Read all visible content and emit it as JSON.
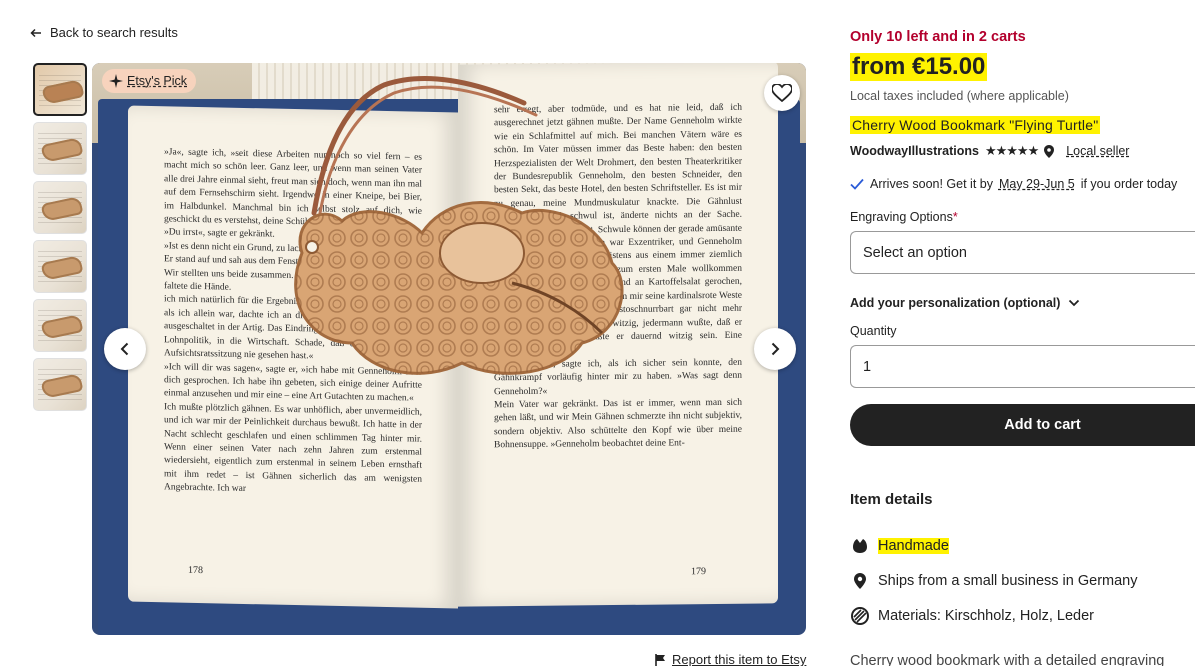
{
  "nav": {
    "back_label": "Back to search results"
  },
  "gallery": {
    "badge": "Etsy's Pick",
    "thumbnail_count": 6,
    "left_page_text": "»Ja«, sagte ich, »seit diese Arbeiten nur noch so viel fern – es macht mich so schön leer. Ganz leer, und wenn man seinen Vater alle drei Jahre einmal sieht, freut man sich doch, wenn man ihn mal auf dem Fernsehschirm sieht. Irgendwo in einer Kneipe, bei Bier, im Halbdunkel. Manchmal bin ich selbst stolz auf dich, wie geschickt du es verstehst, deine Schüler zur Prozentzahl fragt.«\n»Du irrst«, sagte er gekränkt.\n»Ist es denn nicht ein Grund, zu lachen, wenn alle haben?«\nEr stand auf und sah aus dem Fenster.\nWir stellten uns beide zusammen. Er lehnte sich auf die Lehne. Ich faltete die Hände.\nich mich natürlich für die Ergebnisse der Umfrage, mime. Einmal, als ich allein war, dachte ich an die Arbeit saß, hab ich den Ton ausgeschaltet in der Artig. Das Eindringen des l'art pour l'art in die Lohnpolitik, in die Wirtschaft. Schade, daß du damals diesen Aufsichtsratssitzung nie gesehen hast.«\n»Ich will dir was sagen«, sagte er, »ich habe mit Genneholm über dich gesprochen. Ich habe ihn gebeten, sich einige deiner Aufritte einmal anzusehen und mir eine – eine Art Gutachten zu machen.«\nIch mußte plötzlich gähnen. Es war unhöflich, aber unvermeidlich, und ich war mir der Peinlichkeit durchaus bewußt. Ich hatte in der Nacht schlecht geschlafen und einen schlimmen Tag hinter mir. Wenn einer seinen Vater nach zehn Jahren zum erstenmal wiedersieht, eigentlich zum erstenmal in seinem Leben ernsthaft mit ihm redet – ist Gähnen sicherlich das am wenigsten Angebrachte. Ich war",
    "left_page_number": "178",
    "right_page_text": "sehr erregt, aber todmüde, und es hat nie leid, daß ich ausgerechnet jetzt gähnen mußte. Der Name Genneholm wirkte wie ein Schlafmittel auf mich. Bei manchen Vätern wäre es schön. Im Vater müssen immer das Beste haben: den besten Herzspezialisten der Welt Drohmert, den besten Theaterkritiker der Bundesrepublik Genneholm, den besten Schneider, den besten Sekt, das beste Hotel, den besten Schriftsteller. Es ist mir zu genau, meine Mundmuskulatur knackte. Die Gähnlust schwoll, und ich schwul ist, änderte nichts an der Sache. Langeweile in mir auslöst. Schwule können der gerade amüsante Leute sein, und Genneholm war Exzentriker, und Genneholm war mißtrauisch. Er kam meistens aus einem immer ziemlich und ist völlkommen über-nd zum ersten Male wollkommen über-zu und an zehnten Mahl-und an Kartoffelsalat gerochen, und angesichts des Geruchs kamen mir seine kardinalsrote Weste und sein honigfarbener Mephistoschnurrbart gar nicht mehr extravagant vor. Er war sehr witzig, jedermann wußte, daß er witzig war, und so mußte er dauernd witzig sein. Eine ermüdende Existenz.\n»Entschuldige«, sagte ich, als ich sicher sein konnte, den Gähnkrampf vorläufig hinter mir zu haben. »Was sagt denn Genneholm?«\nMein Vater war gekränkt. Das ist er immer, wenn man sich gehen läßt, und wir Mein Gähnen schmerzte ihn nicht subjektiv, sondern objektiv. Also schüttelte den Kopf wie über meine Bohnensuppe. »Genneholm beobachtet deine Ent-",
    "right_page_number": "179"
  },
  "report": {
    "label": "Report this item to Etsy"
  },
  "product": {
    "stock": "Only 10 left and in 2 carts",
    "price": "from €15.00",
    "taxes": "Local taxes included (where applicable)",
    "title": "Cherry Wood Bookmark \"Flying Turtle\"",
    "shop_name": "WoodwayIllustrations",
    "stars": "★★★★★",
    "local_seller": "Local seller",
    "arrives_prefix": "Arrives soon! Get it by",
    "arrives_dates": "May 29-Jun 5",
    "arrives_suffix": "if you order today",
    "engraving_label": "Engraving Options",
    "required_mark": "*",
    "engraving_placeholder": "Select an option",
    "personalization_label": "Add your personalization (optional)",
    "quantity_label": "Quantity",
    "quantity_value": "1",
    "add_to_cart": "Add to cart",
    "item_details_heading": "Item details",
    "details": {
      "handmade": "Handmade",
      "ships_from": "Ships from a small business in Germany",
      "materials": "Materials: Kirschholz, Holz, Leder"
    },
    "description": "Cherry wood bookmark with a detailed engraving"
  },
  "colors": {
    "stock_red": "#b3002d",
    "highlight": "#fff200",
    "button_black": "#222222",
    "badge_peach": "#f7d3bd"
  }
}
